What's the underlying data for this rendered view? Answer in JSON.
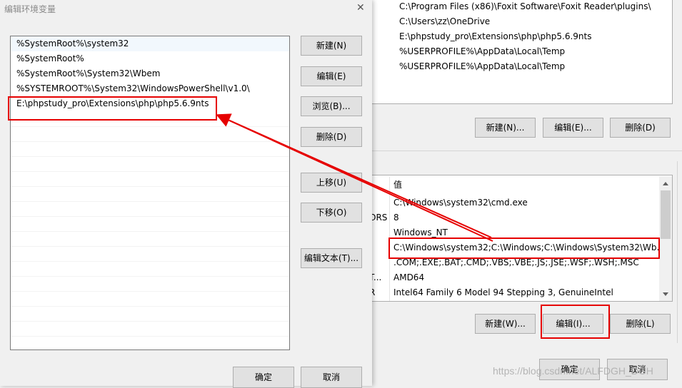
{
  "dialog": {
    "title": "编辑环境变量",
    "close_glyph": "✕",
    "entries": [
      "%SystemRoot%\\system32",
      "%SystemRoot%",
      "%SystemRoot%\\System32\\Wbem",
      "%SYSTEMROOT%\\System32\\WindowsPowerShell\\v1.0\\",
      "E:\\phpstudy_pro\\Extensions\\php\\php5.6.9nts"
    ],
    "buttons": {
      "new": "新建(N)",
      "edit": "编辑(E)",
      "browse": "浏览(B)...",
      "delete": "删除(D)",
      "move_up": "上移(U)",
      "move_down": "下移(O)",
      "edit_text": "编辑文本(T)...",
      "ok": "确定",
      "cancel": "取消"
    }
  },
  "user_vars": {
    "values": [
      "C:\\Program Files (x86)\\Foxit Software\\Foxit Reader\\plugins\\",
      "C:\\Users\\zz\\OneDrive",
      "E:\\phpstudy_pro\\Extensions\\php\\php5.6.9nts",
      "%USERPROFILE%\\AppData\\Local\\Temp",
      "%USERPROFILE%\\AppData\\Local\\Temp"
    ],
    "buttons": {
      "new": "新建(N)...",
      "edit": "编辑(E)...",
      "delete": "删除(D)"
    }
  },
  "system_vars": {
    "value_header": "值",
    "rows": [
      {
        "name": "",
        "value": "C:\\Windows\\system32\\cmd.exe"
      },
      {
        "name": "ORS",
        "value": "8"
      },
      {
        "name": "",
        "value": "Windows_NT"
      },
      {
        "name": "",
        "value": "C:\\Windows\\system32;C:\\Windows;C:\\Windows\\System32\\Wb..."
      },
      {
        "name": "",
        "value": ".COM;.EXE;.BAT;.CMD;.VBS;.VBE;.JS;.JSE;.WSF;.WSH;.MSC"
      },
      {
        "name": "T...",
        "value": "AMD64"
      },
      {
        "name": "R",
        "value": "Intel64 Family 6 Model 94 Stepping 3, GenuineIntel"
      }
    ],
    "buttons": {
      "new": "新建(W)...",
      "edit": "编辑(I)...",
      "delete": "删除(L)"
    }
  },
  "main_buttons": {
    "ok": "确定",
    "cancel": "取消"
  },
  "watermark": "https://blog.csdn.net/ALFDGH_DGH",
  "colors": {
    "annotation_red": "#e60000",
    "button_bg": "#e1e1e1",
    "border": "#adadad"
  }
}
